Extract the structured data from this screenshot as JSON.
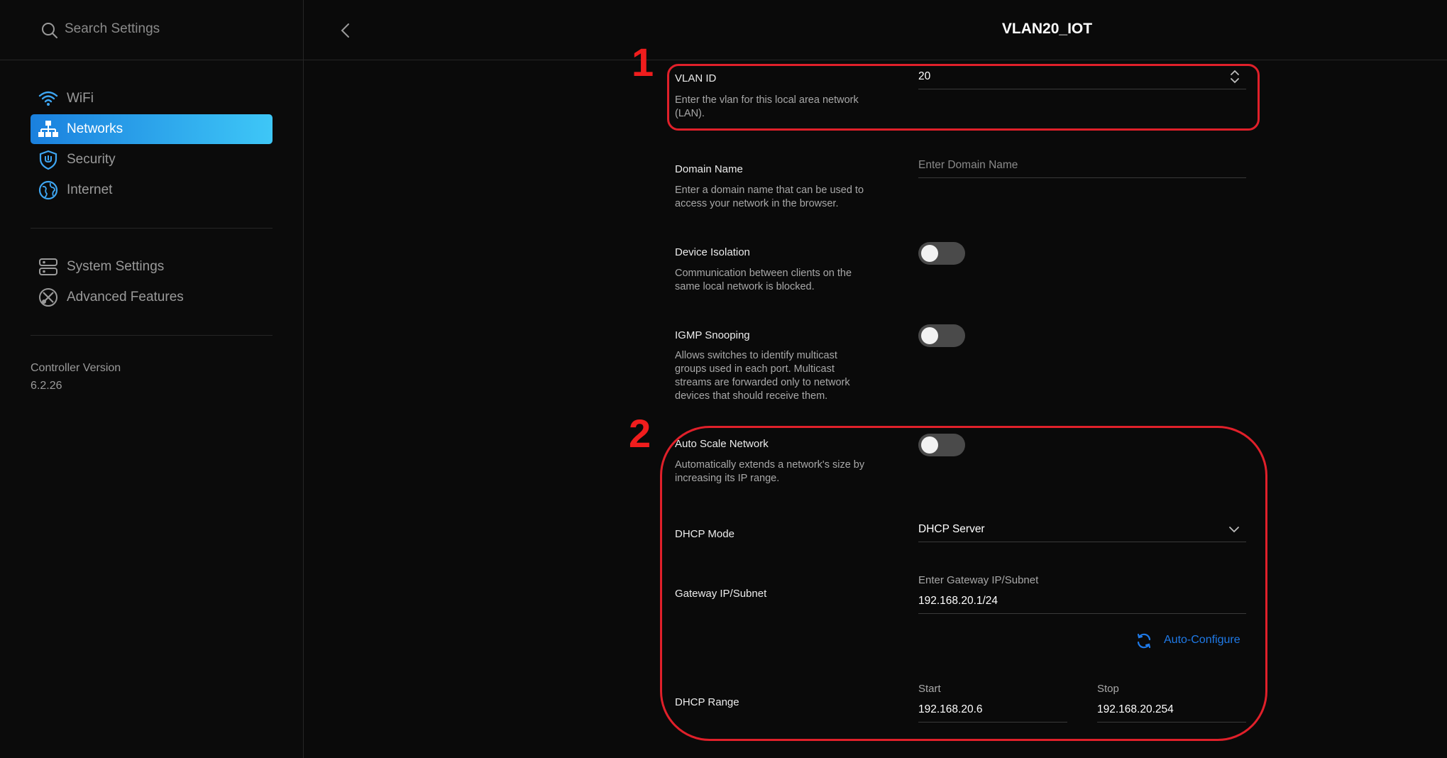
{
  "sidebar": {
    "search_placeholder": "Search Settings",
    "primary_items": [
      {
        "label": "WiFi",
        "icon": "wifi-icon"
      },
      {
        "label": "Networks",
        "icon": "networks-icon",
        "active": true
      },
      {
        "label": "Security",
        "icon": "shield-icon"
      },
      {
        "label": "Internet",
        "icon": "globe-icon"
      }
    ],
    "secondary_items": [
      {
        "label": "System Settings",
        "icon": "system-settings-icon"
      },
      {
        "label": "Advanced Features",
        "icon": "advanced-features-icon"
      }
    ],
    "version_label": "Controller Version",
    "version_value": "6.2.26"
  },
  "header": {
    "title": "VLAN20_IOT"
  },
  "form": {
    "vlan_id": {
      "label": "VLAN ID",
      "desc_line1": "Enter the vlan for this local area network",
      "desc_line2": "(LAN).",
      "value": "20"
    },
    "domain_name": {
      "label": "Domain Name",
      "desc_line1": "Enter a domain name that can be used to",
      "desc_line2": "access your network in the browser.",
      "placeholder": "Enter Domain Name"
    },
    "device_isolation": {
      "label": "Device Isolation",
      "desc_line1": "Communication between clients on the",
      "desc_line2": "same local network is blocked.",
      "enabled": false
    },
    "igmp_snooping": {
      "label": "IGMP Snooping",
      "desc_line1": "Allows switches to identify multicast",
      "desc_line2": "groups used in each port. Multicast",
      "desc_line3": "streams are forwarded only to network",
      "desc_line4": "devices that should receive them.",
      "enabled": false
    },
    "auto_scale": {
      "label": "Auto Scale Network",
      "desc_line1": "Automatically extends a network's size by",
      "desc_line2": "increasing its IP range.",
      "enabled": false
    },
    "dhcp_mode": {
      "label": "DHCP Mode",
      "value": "DHCP Server"
    },
    "gateway": {
      "label": "Gateway IP/Subnet",
      "caption": "Enter Gateway IP/Subnet",
      "value": "192.168.20.1/24"
    },
    "auto_configure_label": "Auto-Configure",
    "dhcp_range": {
      "label": "DHCP Range",
      "start_caption": "Start",
      "start_value": "192.168.20.6",
      "stop_caption": "Stop",
      "stop_value": "192.168.20.254"
    }
  },
  "annotations": {
    "marker1": "1",
    "marker2": "2",
    "color": "#e0202a"
  },
  "colors": {
    "accent": "#1f7ae8",
    "active_gradient_start": "#1a80de",
    "active_gradient_end": "#3ec7f7",
    "background": "#0a0a0a"
  }
}
